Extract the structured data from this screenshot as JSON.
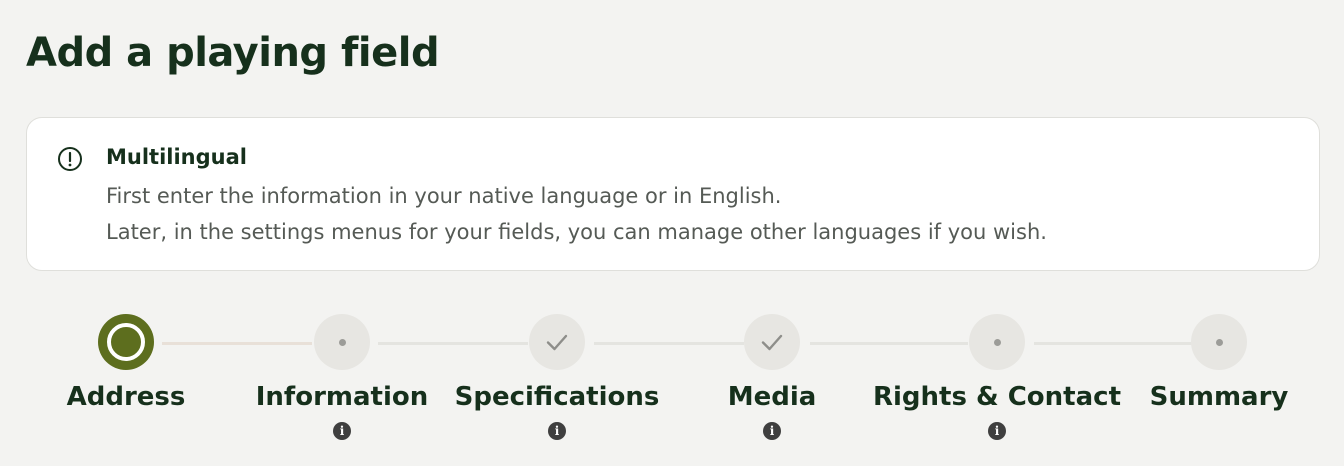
{
  "page": {
    "title": "Add a playing field"
  },
  "notice": {
    "icon": "exclamation-circle-icon",
    "title": "Multilingual",
    "lines": [
      "First enter the information in your native language or in English.",
      "Later, in the settings menus for your fields, you can manage other languages if you wish."
    ]
  },
  "stepper": {
    "steps": [
      {
        "label": "Address",
        "state": "current",
        "has_info": false
      },
      {
        "label": "Information",
        "state": "pending",
        "has_info": true
      },
      {
        "label": "Specifications",
        "state": "completed",
        "has_info": true
      },
      {
        "label": "Media",
        "state": "completed",
        "has_info": true
      },
      {
        "label": "Rights & Contact",
        "state": "pending",
        "has_info": true
      },
      {
        "label": "Summary",
        "state": "pending",
        "has_info": false
      }
    ],
    "info_glyph": "i"
  }
}
